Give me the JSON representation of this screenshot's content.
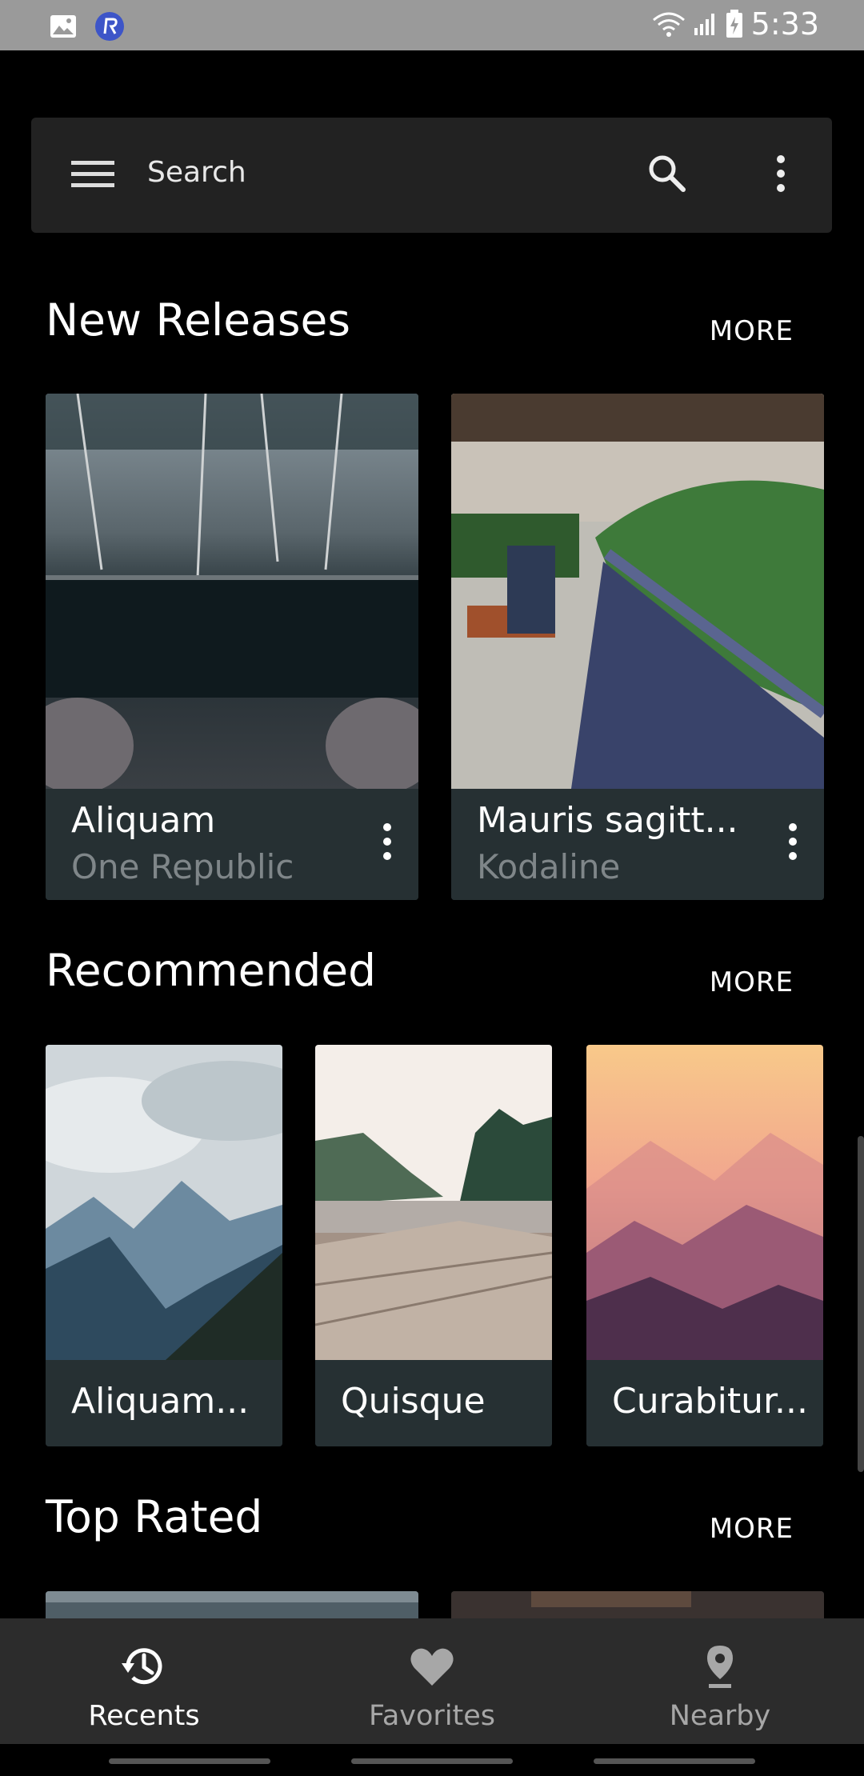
{
  "status_bar": {
    "time": "5:33"
  },
  "search": {
    "placeholder": "Search"
  },
  "sections": {
    "new_releases": {
      "title": "New Releases",
      "more": "MORE",
      "items": [
        {
          "title": "Aliquam",
          "subtitle": "One Republic"
        },
        {
          "title": "Mauris sagitt...",
          "subtitle": "Kodaline"
        }
      ]
    },
    "recommended": {
      "title": "Recommended",
      "more": "MORE",
      "items": [
        {
          "title": "Aliquam..."
        },
        {
          "title": "Quisque"
        },
        {
          "title": "Curabitur..."
        }
      ]
    },
    "top_rated": {
      "title": "Top Rated",
      "more": "MORE"
    }
  },
  "bottom_nav": {
    "items": [
      {
        "label": "Recents",
        "icon": "history-icon",
        "active": true
      },
      {
        "label": "Favorites",
        "icon": "heart-icon",
        "active": false
      },
      {
        "label": "Nearby",
        "icon": "location-pin-icon",
        "active": false
      }
    ]
  },
  "colors": {
    "background": "#000000",
    "card": "#263033",
    "search_bar": "#222222",
    "bottom_nav": "#2c2c2c",
    "status_bar": "#9a9a9a"
  }
}
